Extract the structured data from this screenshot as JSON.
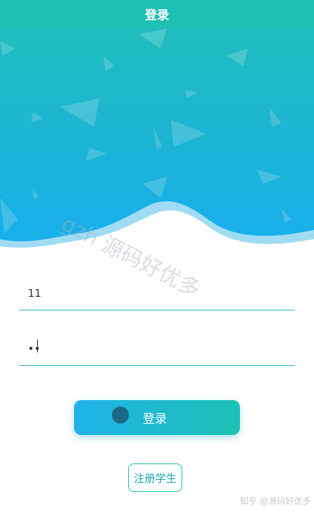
{
  "header": {
    "title": "登录"
  },
  "watermark": {
    "text": "gzh 源码好优多"
  },
  "form": {
    "username_value": "11",
    "password_value": "••"
  },
  "buttons": {
    "login_label": "登录",
    "register_label": "注册学生"
  },
  "footer": {
    "credit": "知乎 @源码好优多"
  },
  "colors": {
    "header": "#1dc0b3",
    "accent": "#20b2ea"
  }
}
